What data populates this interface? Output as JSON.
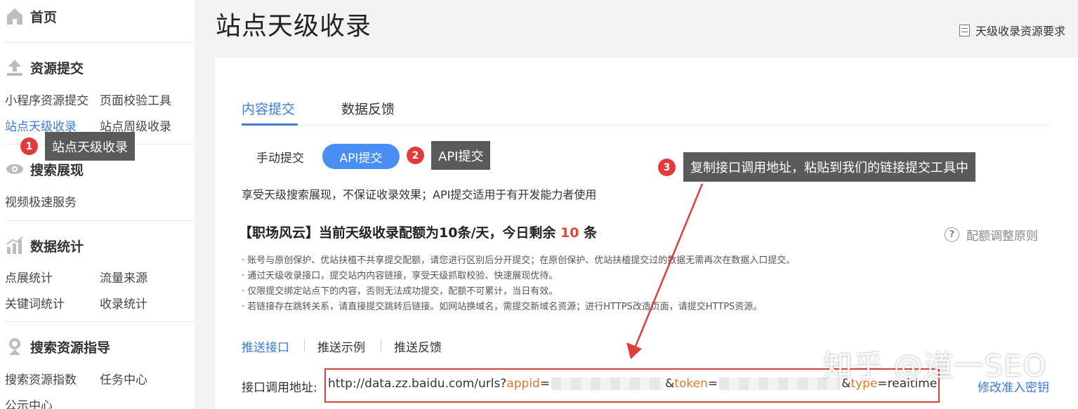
{
  "sidebar": {
    "home": "首页",
    "resource_submit": {
      "title": "资源提交",
      "items": [
        "小程序资源提交",
        "页面校验工具",
        "站点天级收录",
        "站点周级收录"
      ]
    },
    "search_display": {
      "title": "搜索展现",
      "items": [
        "视频极速服务"
      ]
    },
    "data_stats": {
      "title": "数据统计",
      "items": [
        "点展统计",
        "流量来源",
        "关键词统计",
        "收录统计"
      ]
    },
    "search_guide": {
      "title": "搜索资源指导",
      "items": [
        "搜索资源指数",
        "任务中心",
        "公示中心"
      ]
    },
    "active_item": "站点天级收录"
  },
  "annotations": [
    {
      "num": "1",
      "text": "站点天级收录"
    },
    {
      "num": "2",
      "text": "API提交"
    },
    {
      "num": "3",
      "text": "复制接口调用地址，粘贴到我们的链接提交工具中"
    }
  ],
  "header": {
    "title": "站点天级收录",
    "requirements_link": "天级收录资源要求"
  },
  "tabs": [
    "内容提交",
    "数据反馈"
  ],
  "submit_modes": [
    "手动提交",
    "API提交"
  ],
  "description": "享受天级搜索展现，不保证收录效果；API提交适用于有开发能力者使用",
  "quota": {
    "prefix": "【职场风云】当前天级收录配额为10条/天，今日剩余",
    "remaining": "10",
    "suffix": "条"
  },
  "quota_rule_link": "配额调整原则",
  "notes": [
    "· 账号与原创保护、优站扶植不共享提交配额，请您进行区别后分开提交；在原创保护、优站扶植提交过的数据无需再次在数据入口提交。",
    "· 通过天级收录接口，提交站内内容链接，享受天级抓取校验、快速展现优待。",
    "· 仅限提交绑定站点下的内容，否则无法成功提交，配额不可累计，当日有效。",
    "· 若链接存在跳转关系，请直接提交跳转后链接。如网站换域名，需提交新域名资源；进行HTTPS改造页面，请提交HTTPS资源。"
  ],
  "api_tabs": [
    "推送接口",
    "推送示例",
    "推送反馈"
  ],
  "api": {
    "label": "接口调用地址:",
    "url_base": "http://data.zz.baidu.com/urls?",
    "appid_key": "appid",
    "eq1": "=",
    "token_amp": "&",
    "token_key": "token",
    "eq2": "=",
    "type_amp": "&",
    "type_key": "type",
    "type_value": "=realtime",
    "edit_key_link": "修改准入密钥"
  },
  "watermark": "知乎 @道一SEO",
  "colors": {
    "accent": "#3a7bd5",
    "primary_button": "#4a8ef5",
    "highlight_red": "#d9403d",
    "param_orange": "#e0772a",
    "tooltip_bg": "#5a5a5a"
  }
}
